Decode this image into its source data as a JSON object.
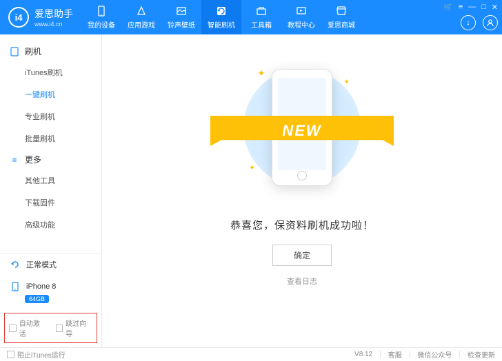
{
  "header": {
    "app_name": "爱思助手",
    "app_url": "www.i4.cn",
    "nav": [
      {
        "label": "我的设备"
      },
      {
        "label": "应用游戏"
      },
      {
        "label": "铃声壁纸"
      },
      {
        "label": "智能刷机"
      },
      {
        "label": "工具箱"
      },
      {
        "label": "教程中心"
      },
      {
        "label": "爱思商城"
      }
    ]
  },
  "sidebar": {
    "group1": {
      "title": "刷机",
      "items": [
        {
          "label": "iTunes刷机"
        },
        {
          "label": "一键刷机"
        },
        {
          "label": "专业刷机"
        },
        {
          "label": "批量刷机"
        }
      ]
    },
    "group2": {
      "title": "更多",
      "items": [
        {
          "label": "其他工具"
        },
        {
          "label": "下载固件"
        },
        {
          "label": "高级功能"
        }
      ]
    },
    "mode": "正常模式",
    "device": "iPhone 8",
    "storage": "64GB",
    "checkbox1": "自动激活",
    "checkbox2": "跳过向导"
  },
  "main": {
    "ribbon": "NEW",
    "message": "恭喜您，保资料刷机成功啦！",
    "ok": "确定",
    "log": "查看日志"
  },
  "footer": {
    "block_itunes": "阻止iTunes运行",
    "version": "V8.12",
    "support": "客服",
    "wechat": "微信公众号",
    "update": "检查更新"
  }
}
